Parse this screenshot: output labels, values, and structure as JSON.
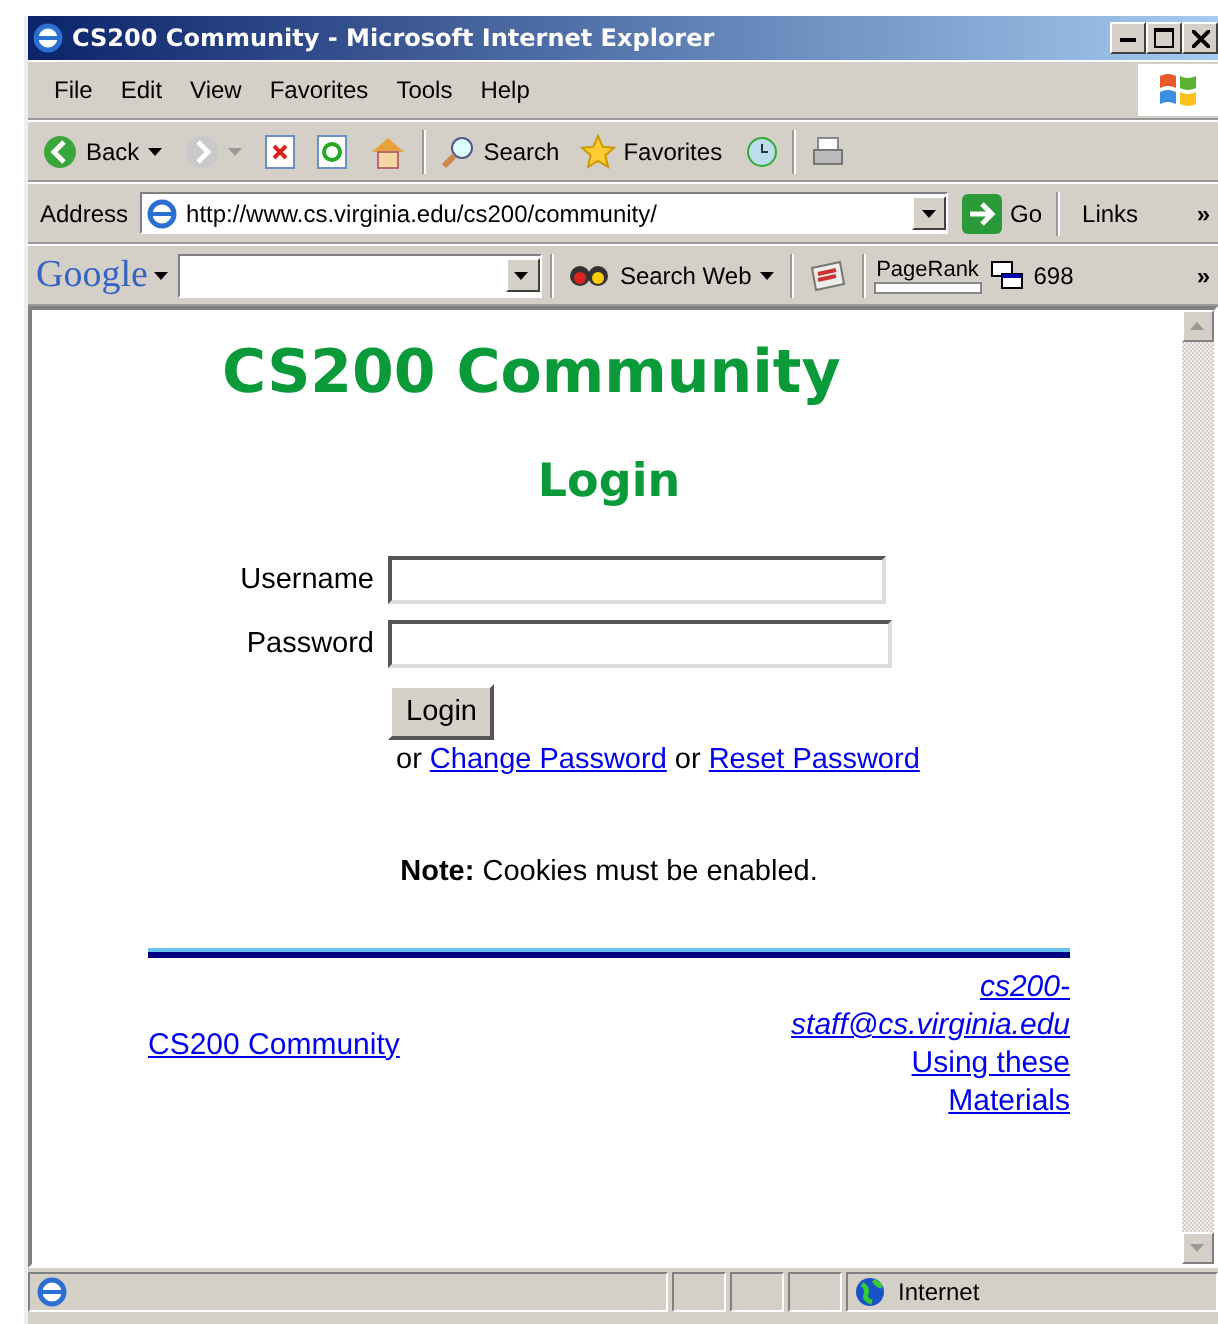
{
  "window": {
    "title": "CS200 Community - Microsoft Internet Explorer"
  },
  "menu": [
    "File",
    "Edit",
    "View",
    "Favorites",
    "Tools",
    "Help"
  ],
  "toolbar": {
    "back": "Back",
    "search": "Search",
    "favorites": "Favorites"
  },
  "address_bar": {
    "label": "Address",
    "url": "http://www.cs.virginia.edu/cs200/community/",
    "go": "Go",
    "links": "Links",
    "more": "»"
  },
  "google_bar": {
    "logo": "Google",
    "search_web": "Search Web",
    "pagerank_label": "PageRank",
    "count": "698",
    "more": "»"
  },
  "page": {
    "title": "CS200 Community",
    "heading": "Login",
    "fields": [
      {
        "label": "Username"
      },
      {
        "label": "Password"
      }
    ],
    "login_button": "Login",
    "or1": "or",
    "change_password": "Change Password",
    "or2": "or",
    "reset_password": "Reset Password",
    "note_label": "Note:",
    "note_text": "Cookies must be enabled.",
    "footer": {
      "home_link": "CS200 Community",
      "email": "cs200-staff@cs.virginia.edu",
      "materials": "Using these Materials"
    }
  },
  "status_bar": {
    "zone": "Internet"
  }
}
